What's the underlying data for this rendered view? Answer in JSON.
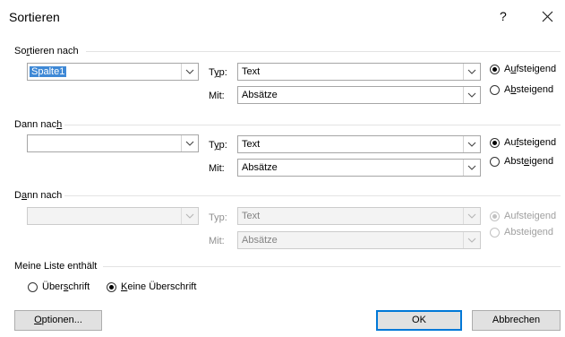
{
  "window": {
    "title": "Sortieren",
    "help": "?"
  },
  "sections": {
    "sort_by": {
      "title": "Sortieren nach",
      "column": "Spalte1",
      "type_label": "Typ:",
      "type_value": "Text",
      "using_label": "Mit:",
      "using_value": "Absätze",
      "asc": "Aufsteigend",
      "desc": "Absteigend",
      "order": "asc"
    },
    "then_by_1": {
      "title": "Dann nach",
      "column": "",
      "type_label": "Typ:",
      "type_value": "Text",
      "using_label": "Mit:",
      "using_value": "Absätze",
      "asc": "Aufsteigend",
      "desc": "Absteigend",
      "order": "asc"
    },
    "then_by_2": {
      "title": "Dann nach",
      "column": "",
      "type_label": "Typ:",
      "type_value": "Text",
      "using_label": "Mit:",
      "using_value": "Absätze",
      "asc": "Aufsteigend",
      "desc": "Absteigend",
      "order": "asc",
      "disabled": true
    }
  },
  "my_list": {
    "title": "Meine Liste enthält",
    "header_option": "Überschrift",
    "no_header_option": "Keine Überschrift",
    "selected": "no_header"
  },
  "buttons": {
    "options": "Optionen...",
    "ok": "OK",
    "cancel": "Abbrechen"
  },
  "colors": {
    "accent": "#0078d7",
    "selection": "#3f89d6"
  }
}
